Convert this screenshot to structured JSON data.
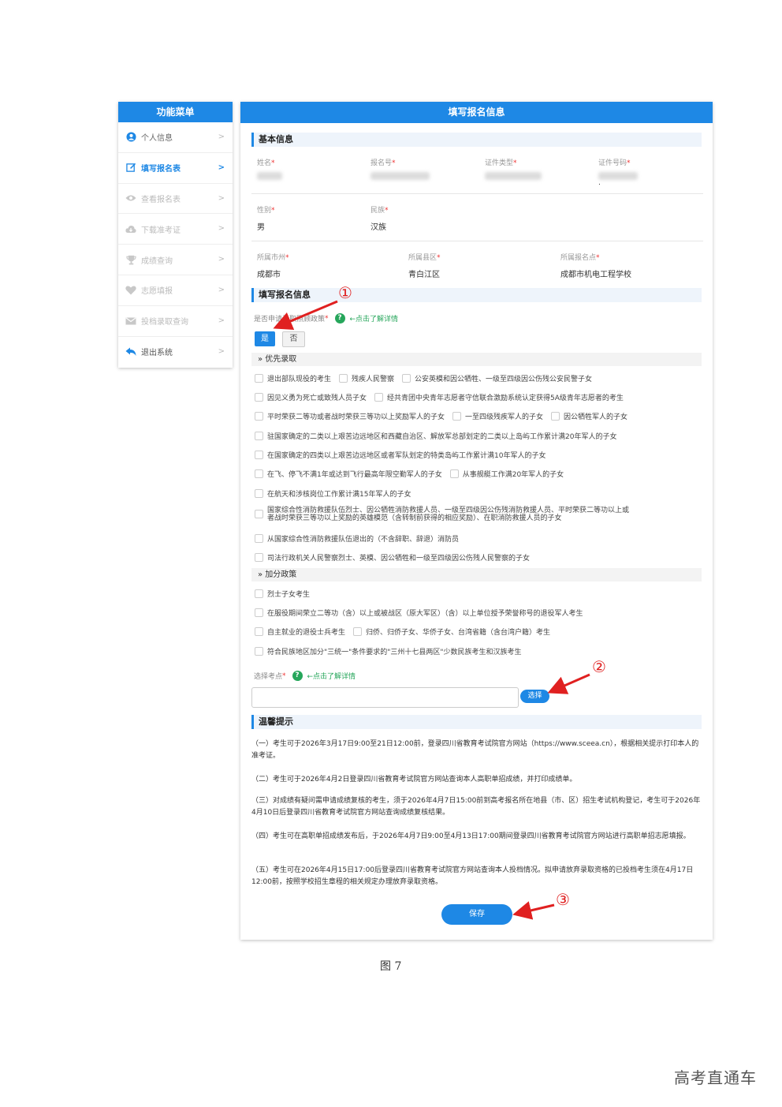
{
  "sidebar": {
    "title": "功能菜单",
    "items": [
      {
        "label": "个人信息"
      },
      {
        "label": "填写报名表"
      },
      {
        "label": "查看报名表"
      },
      {
        "label": "下载准考证"
      },
      {
        "label": "成绩查询"
      },
      {
        "label": "志愿填报"
      },
      {
        "label": "投档录取查询"
      },
      {
        "label": "退出系统"
      }
    ]
  },
  "main": {
    "title": "填写报名信息",
    "basic": {
      "section_title": "基本信息",
      "name_label": "姓名",
      "regno_label": "报名号",
      "idtype_label": "证件类型",
      "idno_label": "证件号码",
      "idno_value": ".",
      "gender_label": "性别",
      "gender_value": "男",
      "ethnic_label": "民族",
      "ethnic_value": "汉族",
      "city_label": "所属市州",
      "city_value": "成都市",
      "county_label": "所属县区",
      "county_value": "青白江区",
      "site_label": "所属报名点",
      "site_value": "成都市机电工程学校",
      "required_mark": "*"
    },
    "apply": {
      "section_title": "填写报名信息",
      "policy_question": "是否申请录取照顾政策",
      "help_icon": "?",
      "help_link": "←点击了解详情",
      "yes_label": "是",
      "no_label": "否",
      "priority_title": "优先录取",
      "priority_rows": [
        [
          "退出部队现役的考生",
          "残疾人民警察",
          "公安英模和因公牺牲、一级至四级因公伤残公安民警子女"
        ],
        [
          "因见义勇为死亡或致残人员子女",
          "经共青团中央青年志愿者守信联合激励系统认定获得5A级青年志愿者的考生"
        ],
        [
          "平时荣获二等功或者战时荣获三等功以上奖励军人的子女",
          "一至四级残疾军人的子女",
          "因公牺牲军人的子女"
        ],
        [
          "驻国家确定的二类以上艰苦边远地区和西藏自治区、解放军总部划定的二类以上岛屿工作累计满20年军人的子女"
        ],
        [
          "在国家确定的四类以上艰苦边远地区或者军队划定的特类岛屿工作累计满10年军人的子女"
        ],
        [
          "在飞、停飞不满1年或达到飞行最高年限空勤军人的子女",
          "从事舰艇工作满20年军人的子女"
        ],
        [
          "在航天和涉核岗位工作累计满15年军人的子女"
        ]
      ],
      "priority_long_line1": "国家综合性消防救援队伍烈士、因公牺牲消防救援人员、一级至四级因公伤残消防救援人员、平时荣获二等功以上或",
      "priority_long_line2": "者战时荣获三等功以上奖励的英雄模范（含转制前获得的相应奖励）、在职消防救援人员的子女",
      "priority_tail": [
        "从国家综合性消防救援队伍退出的（不含辞职、辞退）消防员",
        "司法行政机关人民警察烈士、英模、因公牺牲和一级至四级因公伤残人民警察的子女"
      ],
      "bonus_title": "加分政策",
      "bonus_rows": [
        [
          "烈士子女考生"
        ],
        [
          "在服役期间荣立二等功（含）以上或被战区（原大军区）（含）以上单位授予荣誉称号的退役军人考生"
        ],
        [
          "自主就业的退役士兵考生",
          "归侨、归侨子女、华侨子女、台湾省籍（含台湾户籍）考生"
        ],
        [
          "符合民族地区加分\"三统一\"条件要求的\"三州十七县两区\"少数民族考生和汉族考生"
        ]
      ],
      "site_choose_label": "选择考点",
      "choose_button": "选择"
    },
    "tips": {
      "section_title": "温馨提示",
      "items": [
        "（一）考生可于2026年3月17日9:00至21日12:00前，登录四川省教育考试院官方网站（https://www.sceea.cn），根据相关提示打印本人的准考证。",
        "（二）考生可于2026年4月2日登录四川省教育考试院官方网站查询本人高职单招成绩，并打印成绩单。",
        "（三）对成绩有疑问需申请成绩复核的考生，须于2026年4月7日15:00前到高考报名所在地县（市、区）招生考试机构登记，考生可于2026年4月10日后登录四川省教育考试院官方网站查询成绩复核结果。",
        "（四）考生可在高职单招成绩发布后，于2026年4月7日9:00至4月13日17:00期间登录四川省教育考试院官方网站进行高职单招志愿填报。",
        "（五）考生可在2026年4月15日17:00后登录四川省教育考试院官方网站查询本人投档情况。拟申请放弃录取资格的已投档考生须在4月17日12:00前，按照学校招生章程的相关规定办理放弃录取资格。"
      ]
    },
    "save_button": "保存"
  },
  "annotations": {
    "one": "①",
    "two": "②",
    "three": "③",
    "color": "#e02020"
  },
  "caption": "图 7",
  "watermark": "高考直通车",
  "colors": {
    "primary": "#1e88e5",
    "help": "#26a65b",
    "required": "#e33333"
  }
}
